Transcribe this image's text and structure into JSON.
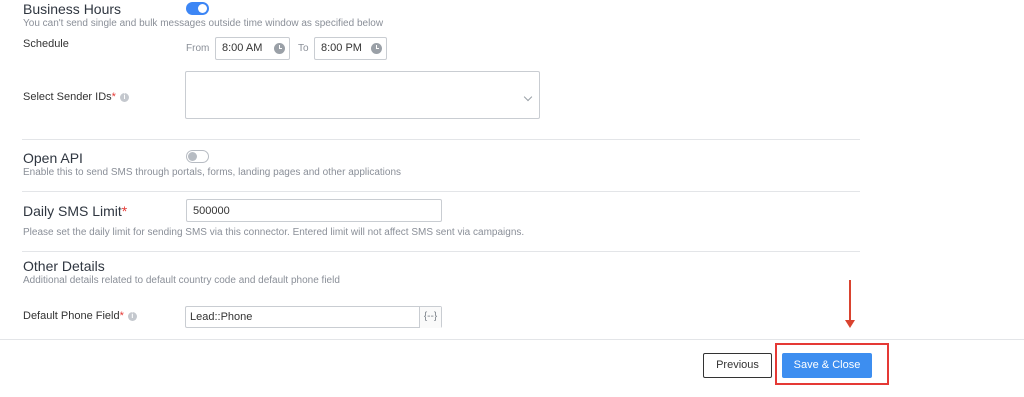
{
  "business_hours": {
    "title": "Business Hours",
    "enabled": true,
    "description": "You can't send single and bulk messages outside time window as specified below",
    "schedule_label": "Schedule",
    "from_label": "From",
    "from_value": "8:00 AM",
    "to_label": "To",
    "to_value": "8:00 PM"
  },
  "sender_ids": {
    "label": "Select Sender IDs",
    "required_mark": "*",
    "info_icon": "info-icon",
    "value": ""
  },
  "open_api": {
    "title": "Open API",
    "enabled": false,
    "description": "Enable this to send SMS through portals, forms, landing pages and other applications"
  },
  "daily_limit": {
    "title": "Daily SMS Limit",
    "required_mark": "*",
    "value": "500000",
    "description": "Please set the daily limit for sending SMS via this connector. Entered limit will not affect SMS sent via campaigns."
  },
  "other_details": {
    "title": "Other Details",
    "description": "Additional details related to default country code and default phone field",
    "phone_field_label": "Default Phone Field",
    "required_mark": "*",
    "phone_field_value": "Lead::Phone",
    "token_button": "{--}"
  },
  "footer": {
    "previous_label": "Previous",
    "save_label": "Save & Close"
  },
  "colors": {
    "accent": "#3d8ef0",
    "toggle_on": "#3d86f5",
    "annotation": "#e53935"
  }
}
